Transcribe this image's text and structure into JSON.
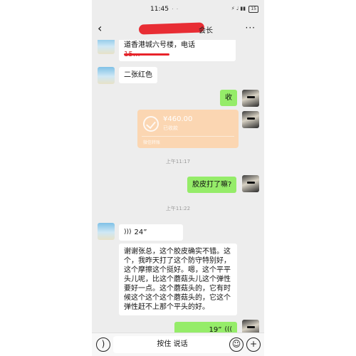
{
  "status_bar": {
    "time": "11:45",
    "indicators": "· · ·",
    "right_text": "⚡ ♩ ▮▮",
    "battery": "15"
  },
  "header": {
    "back_icon": "back-chevron-icon",
    "title": "会长",
    "more_icon": "more-dots-icon"
  },
  "messages": {
    "address_line": "道香港城六号楼，电话",
    "address_redacted": "15…",
    "two_red": "二张红色",
    "received": "收",
    "transfer": {
      "amount": "¥460.00",
      "state": "已收款",
      "footer": "微信转账"
    },
    "time_1": "上午11:17",
    "question": "胶皮打了嘛?",
    "time_2": "上午11:22",
    "voice_left": "24”",
    "long_text": "谢谢张总，这个胶皮确实不错。这个，我昨天打了这个防守特别好，这个摩擦这个挺好。嗯，这个平平头儿呢，比这个蘑菇头儿这个弹性要好一点。这个蘑菇头的，它有时候这个这个这个蘑菇头的，它这个弹性赶不上那个平头的好。",
    "voice_right": "19”"
  },
  "input_bar": {
    "voice_icon": "voice-toggle-icon",
    "hold_to_talk": "按住 说话",
    "emoji_icon": "emoji-icon",
    "plus_icon": "plus-icon",
    "emoji_glyph": "☺",
    "plus_glyph": "+"
  }
}
